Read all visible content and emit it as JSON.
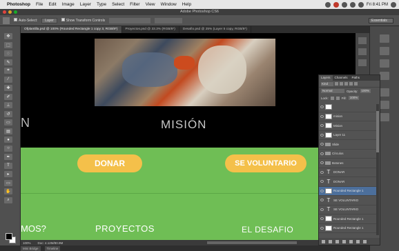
{
  "menubar": {
    "app": "Photoshop",
    "items": [
      "File",
      "Edit",
      "Image",
      "Layer",
      "Type",
      "Select",
      "Filter",
      "View",
      "Window",
      "Help"
    ],
    "clock": "Fri 8:41 PM"
  },
  "window": {
    "title": "Adobe Photoshop CS6"
  },
  "options": {
    "auto_select_label": "Auto-Select:",
    "auto_select_value": "Layer",
    "transform_label": "Show Transform Controls",
    "workspace": "Essentials"
  },
  "tabs": [
    {
      "label": "Ofplantilla.psd @ 100% (Rounded Rectangle 1 copy 3, RGB/8*)",
      "active": true
    },
    {
      "label": "Proyectos.psd @ 33.3% (RGB/8*)",
      "active": false
    },
    {
      "label": "Desafio.psd @ 25% (Layer 5 copy, RGB/8*)",
      "active": false
    }
  ],
  "canvas": {
    "left_heading": "N",
    "mision": "MISIÓN",
    "donar_button": "DONAR",
    "voluntario_button": "SE VOLUNTARIO",
    "nav_left": "MOS?",
    "nav_proyectos": "PROYECTOS",
    "nav_desafio": "EL DESAFIO"
  },
  "layers_panel": {
    "tabs": [
      "Layers",
      "Channels",
      "Paths"
    ],
    "kind_label": "Kind",
    "blend_mode": "Normal",
    "opacity_label": "Opacity:",
    "opacity_value": "100%",
    "lock_label": "Lock:",
    "fill_label": "Fill:",
    "fill_value": "100%",
    "layers": [
      {
        "type": "thumb",
        "name": ""
      },
      {
        "type": "thumb",
        "name": "mision"
      },
      {
        "type": "thumb",
        "name": "Mision"
      },
      {
        "type": "thumb",
        "name": "Layer 11"
      },
      {
        "type": "folder",
        "name": "Slide"
      },
      {
        "type": "folder",
        "name": "Círculos"
      },
      {
        "type": "folder",
        "name": "Botones"
      },
      {
        "type": "text",
        "name": "DONAR"
      },
      {
        "type": "text",
        "name": "DONAR"
      },
      {
        "type": "thumb",
        "name": "Rounded Rectangle 1",
        "selected": true
      },
      {
        "type": "text",
        "name": "SE VOLUNTARIO"
      },
      {
        "type": "text",
        "name": "SE VOLUNTARIO"
      },
      {
        "type": "thumb",
        "name": "Rounded Rectangle 1"
      },
      {
        "type": "thumb",
        "name": "Rounded Rectangle 1"
      }
    ]
  },
  "statusbar": {
    "zoom": "100%",
    "doc": "Doc: 4.12M/80.9M"
  },
  "bottombar": {
    "tabs": [
      "Mini Bridge",
      "Timeline"
    ]
  }
}
